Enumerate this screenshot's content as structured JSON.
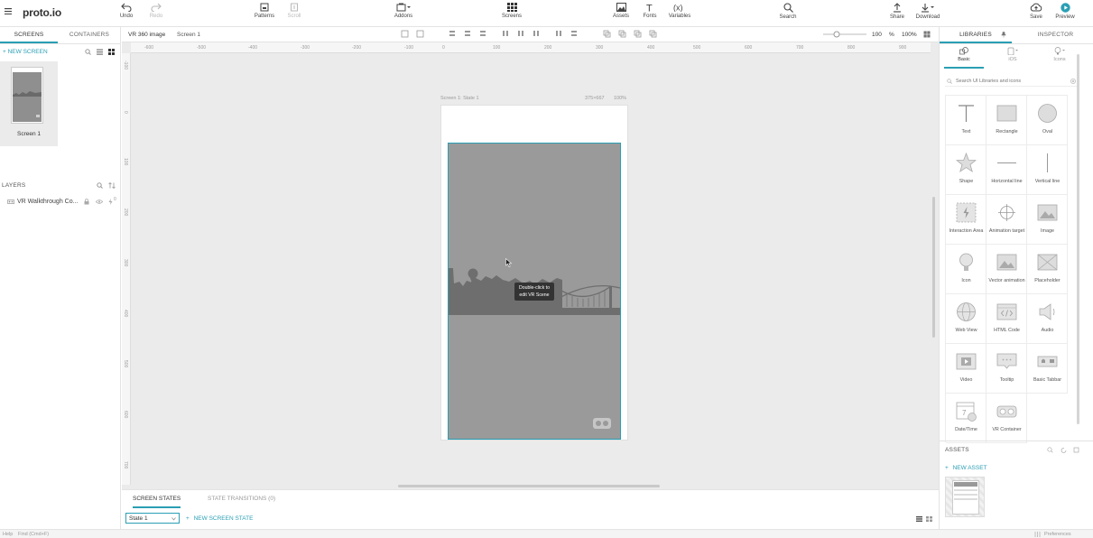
{
  "app": {
    "logo": "proto.io"
  },
  "toolbar": {
    "undo": "Undo",
    "redo": "Redo",
    "patterns": "Patterns",
    "scroll": "Scroll",
    "addons": "Addons",
    "screens": "Screens",
    "assets": "Assets",
    "fonts": "Fonts",
    "variables": "Variables",
    "variables_icon": "(x)",
    "fonts_icon": "T",
    "search": "Search",
    "share": "Share",
    "download": "Download",
    "save": "Save",
    "preview": "Preview"
  },
  "left": {
    "tabs": [
      "SCREENS",
      "CONTAINERS"
    ],
    "new_screen": "NEW SCREEN",
    "screen_name": "Screen 1",
    "layers_title": "LAYERS",
    "layer_item": "VR Walkthrough Co...",
    "layer_badge": "0"
  },
  "editbar": {
    "breadcrumb": [
      "VR 360 image",
      "Screen 1"
    ],
    "zoom_value": "100",
    "zoom_unit": "%",
    "zoom_fit": "100%"
  },
  "ruler": {
    "h_ticks": [
      "-600",
      "-500",
      "-400",
      "-300",
      "-200",
      "-100",
      "0",
      "100",
      "200",
      "300",
      "400",
      "500",
      "600",
      "700",
      "800",
      "900"
    ],
    "v_ticks": [
      "-100",
      "0",
      "100",
      "200",
      "300",
      "400",
      "500",
      "600",
      "700"
    ]
  },
  "canvas": {
    "device_label": "Screen 1: State 1",
    "device_size": "375×667",
    "device_zoom": "100%",
    "tooltip_line1": "Double-click to",
    "tooltip_line2": "edit VR Scene"
  },
  "bottom": {
    "tabs": [
      "SCREEN STATES",
      "STATE TRANSITIONS (0)"
    ],
    "state_select": "State 1",
    "new_state": "NEW SCREEN STATE"
  },
  "status": {
    "help": "Help",
    "find": "Find (Cmd+F)",
    "preferences": "Preferences"
  },
  "right": {
    "tabs": [
      "LIBRARIES",
      "INSPECTOR"
    ],
    "lib_tabs": [
      "Basic",
      "iOS",
      "Icons"
    ],
    "search_placeholder": "Search UI Libraries and icons",
    "items": [
      "Text",
      "Rectangle",
      "Oval",
      "Shape",
      "Horizontal line",
      "Vertical line",
      "Interaction Area",
      "Animation target",
      "Image",
      "Icon",
      "Vector animation",
      "Placeholder",
      "Web View",
      "HTML Code",
      "Audio",
      "Video",
      "Tooltip",
      "Basic Tabbar",
      "Date/Time",
      "VR Container"
    ],
    "assets_title": "ASSETS",
    "new_asset": "NEW ASSET"
  },
  "colors": {
    "accent": "#2a9fb4",
    "preview": "#2a9fb4",
    "canvas_bg": "#ebebeb",
    "vr_bg": "#9a9a9a"
  }
}
